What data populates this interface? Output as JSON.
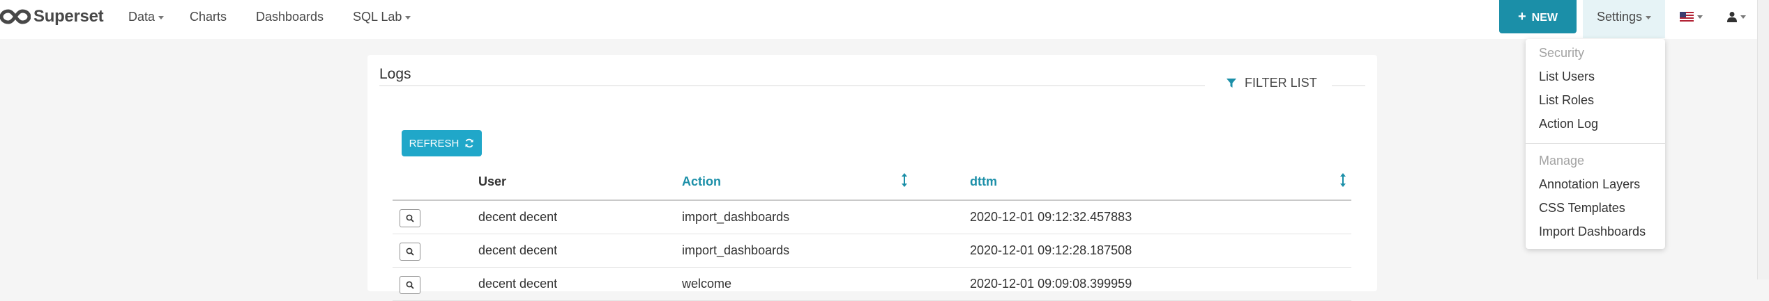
{
  "brand": {
    "name": "Superset"
  },
  "nav": {
    "data_label": "Data",
    "charts_label": "Charts",
    "dashboards_label": "Dashboards",
    "sqllab_label": "SQL Lab"
  },
  "right_menu": {
    "new_label": "NEW",
    "settings_label": "Settings"
  },
  "settings_menu": {
    "security_header": "Security",
    "list_users": "List Users",
    "list_roles": "List Roles",
    "action_log": "Action Log",
    "manage_header": "Manage",
    "annotation_layers": "Annotation Layers",
    "css_templates": "CSS Templates",
    "import_dashboards": "Import Dashboards"
  },
  "logs": {
    "title": "Logs",
    "filter_list_label": "FILTER LIST",
    "refresh_label": "REFRESH",
    "columns": {
      "user": "User",
      "action": "Action",
      "dttm": "dttm"
    },
    "rows": [
      {
        "user": "decent decent",
        "action": "import_dashboards",
        "dttm": "2020-12-01 09:12:32.457883"
      },
      {
        "user": "decent decent",
        "action": "import_dashboards",
        "dttm": "2020-12-01 09:12:28.187508"
      },
      {
        "user": "decent decent",
        "action": "welcome",
        "dttm": "2020-12-01 09:09:08.399959"
      }
    ]
  },
  "colors": {
    "primary": "#20a7c9",
    "primary_dark": "#1b8fa8",
    "settings_active_bg": "#e6f3f6"
  }
}
